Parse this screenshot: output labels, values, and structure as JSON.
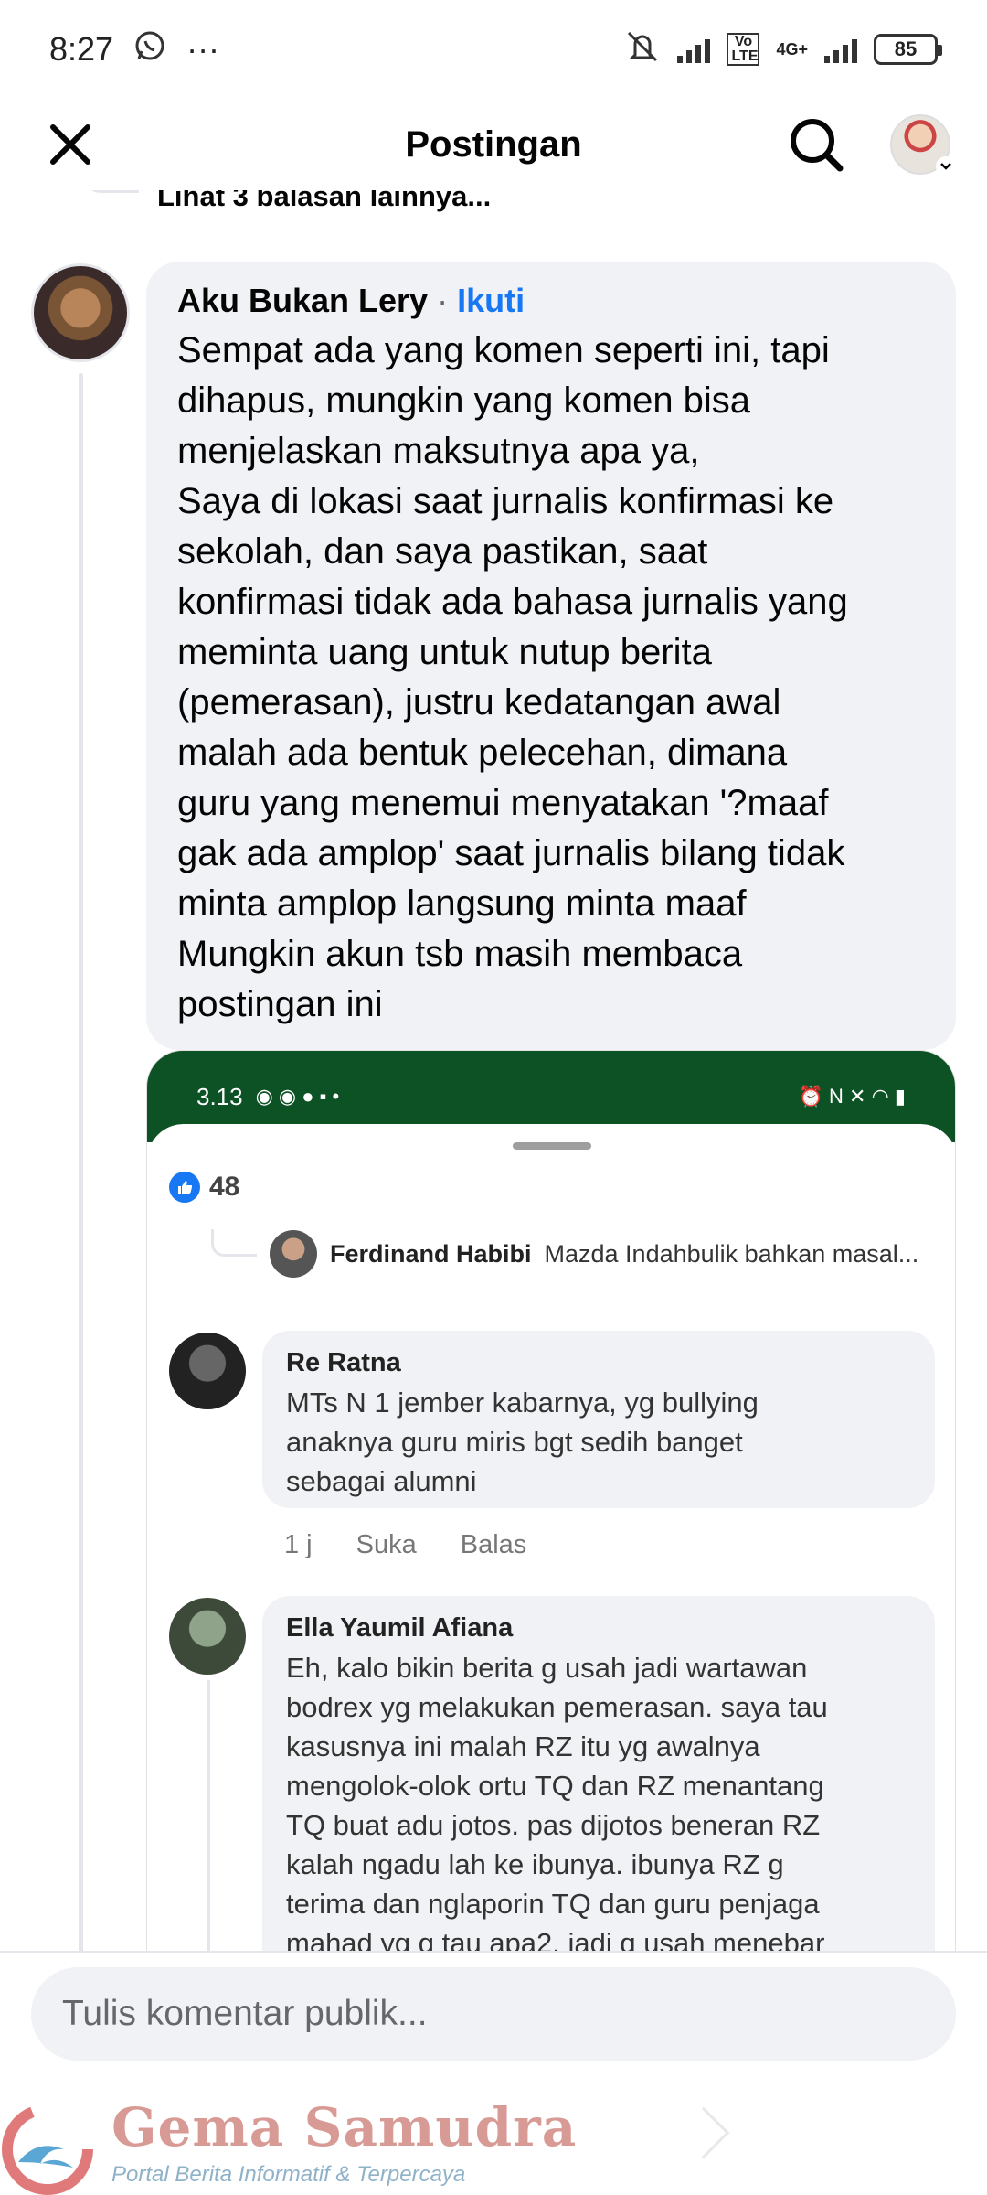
{
  "status_bar": {
    "time": "8:27",
    "more": "···",
    "network_label": "4G+",
    "volte_label": "Vo LTE",
    "battery": "85"
  },
  "header": {
    "title": "Postingan"
  },
  "previous_reply": {
    "label": "Lihat 3 balasan lainnya..."
  },
  "comment": {
    "author": "Aku Bukan Lery",
    "separator": "·",
    "follow_label": "Ikuti",
    "text": "Sempat ada yang komen seperti ini, tapi\ndihapus, mungkin yang komen bisa\nmenjelaskan maksutnya apa ya,\nSaya di lokasi saat jurnalis konfirmasi ke\nsekolah, dan saya pastikan, saat\nkonfirmasi tidak ada bahasa jurnalis yang\nmeminta uang untuk nutup berita\n(pemerasan), justru kedatangan awal\nmalah ada bentuk pelecehan, dimana\nguru yang menemui menyatakan '?maaf\ngak ada amplop' saat jurnalis bilang tidak\nminta amplop langsung minta maaf\nMungkin akun tsb masih membaca\npostingan ini"
  },
  "attached_screenshot": {
    "status_time": "3.13",
    "likes_count": "48",
    "reply_preview": {
      "name": "Ferdinand Habibi",
      "text": "Mazda Indahbulik bahkan masal..."
    },
    "comments": [
      {
        "name": "Re Ratna",
        "text": "MTs N 1 jember kabarnya, yg bullying\nanaknya guru miris bgt sedih banget\nsebagai alumni",
        "time": "1 j",
        "like_label": "Suka",
        "reply_label": "Balas"
      },
      {
        "name": "Ella Yaumil Afiana",
        "text": "Eh, kalo bikin berita g usah jadi wartawan\nbodrex yg melakukan pemerasan. saya tau\nkasusnya ini malah RZ itu yg awalnya\nmengolok-olok ortu TQ dan RZ menantang\nTQ buat adu jotos. pas dijotos beneran RZ\nkalah ngadu lah ke ibunya. ibunya RZ g\nterima dan nglaporin TQ dan guru penjaga\nmahad yg g tau apa2. jadi g usah menebar\nfitnah dan menebar pemerasan deh. catatan"
      }
    ]
  },
  "composer": {
    "placeholder": "Tulis komentar publik..."
  },
  "watermark": {
    "title": "Gema Samudra",
    "subtitle": "Portal Berita Informatif & Terpercaya"
  },
  "colors": {
    "accent": "#1877f2",
    "bubble": "#f0f2f5",
    "screenshot_status": "#0d5224"
  }
}
